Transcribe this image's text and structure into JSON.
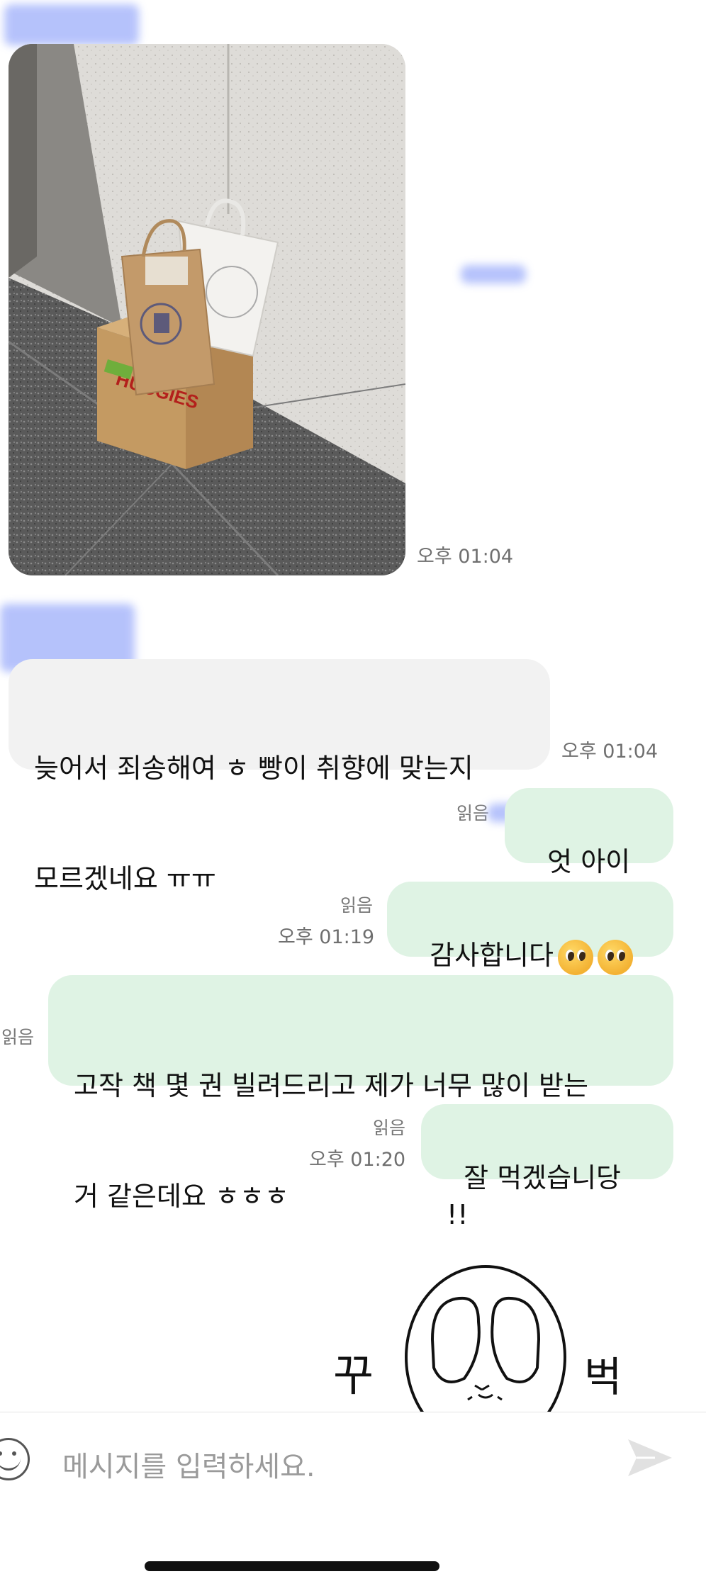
{
  "photo_message": {
    "time": "오후 01:04"
  },
  "incoming_1": {
    "lines": [
      "늦어서 죄송해여 ㅎ 빵이 취향에 맞는지",
      "모르겠네요 ㅠㅠ"
    ],
    "time": "오후 01:04"
  },
  "outgoing": [
    {
      "text": "엇 아이고",
      "read": "읽음",
      "time": ""
    },
    {
      "text": "감사합니다",
      "read": "읽음",
      "time": "오후 01:19"
    },
    {
      "lines": [
        "고작 책 몇 권 빌려드리고 제가 너무 많이 받는",
        "거 같은데요 ㅎㅎㅎ"
      ],
      "read": "읽음",
      "time": ""
    },
    {
      "text": "잘 먹겠습니당 !!",
      "read": "읽음",
      "time": "오후 01:20"
    }
  ],
  "sticker": {
    "left_text": "꾸",
    "right_text": "벅"
  },
  "composer": {
    "placeholder": "메시지를 입력하세요."
  },
  "icons": [
    "emoji-icon",
    "send-icon"
  ],
  "colors": {
    "outgoing_bubble": "#dff3e4",
    "incoming_bubble": "#f2f2f2"
  }
}
